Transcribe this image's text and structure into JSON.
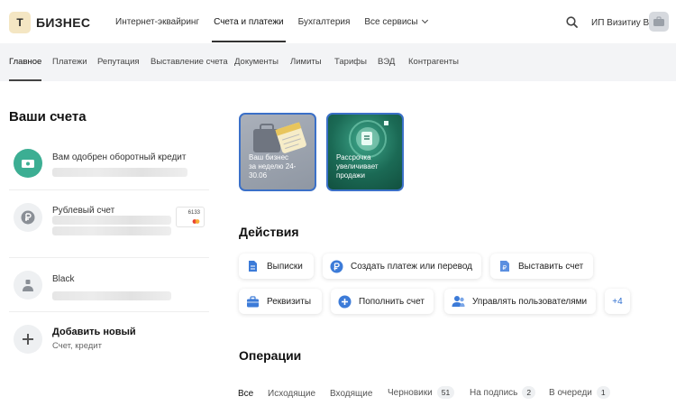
{
  "brand": {
    "logo_letter": "Т",
    "name": "БИЗНЕС"
  },
  "top_nav": [
    {
      "label": "Интернет-эквайринг",
      "active": false
    },
    {
      "label": "Счета и платежи",
      "active": true
    },
    {
      "label": "Бухгалтерия",
      "active": false
    },
    {
      "label": "Все сервисы",
      "active": false
    }
  ],
  "user": {
    "name": "ИП Визитиу В."
  },
  "sub_nav": [
    {
      "label": "Главное",
      "active": true
    },
    {
      "label": "Платежи"
    },
    {
      "label": "Репутация"
    },
    {
      "label": "Выставление счета"
    },
    {
      "label": "Документы"
    },
    {
      "label": "Лимиты"
    },
    {
      "label": "Тарифы"
    },
    {
      "label": "ВЭД"
    },
    {
      "label": "Контрагенты"
    }
  ],
  "accounts": {
    "title": "Ваши счета",
    "items": [
      {
        "label": "Вам одобрен оборотный кредит",
        "icon": "banknote-icon",
        "color": "#3cae93"
      },
      {
        "label": "Рублевый счет",
        "icon": "ruble-icon",
        "card_last4": "6133"
      },
      {
        "label": "Black",
        "icon": "person-icon"
      }
    ],
    "add": {
      "title": "Добавить новый",
      "subtitle": "Счет, кредит"
    }
  },
  "promos": [
    {
      "text_lines": [
        "Ваш бизнес",
        "за неделю 24-",
        "30.06"
      ]
    },
    {
      "text_lines": [
        "Рассрочка",
        "увеличивает",
        "продажи"
      ]
    }
  ],
  "actions": {
    "title": "Действия",
    "buttons": [
      {
        "label": "Выписки",
        "icon": "document-icon"
      },
      {
        "label": "Создать платеж или перевод",
        "icon": "ruble-circle-icon"
      },
      {
        "label": "Выставить счет",
        "icon": "invoice-icon"
      },
      {
        "label": "Реквизиты",
        "icon": "briefcase-icon"
      },
      {
        "label": "Пополнить счет",
        "icon": "plus-circle-icon"
      },
      {
        "label": "Управлять пользователями",
        "icon": "users-icon"
      }
    ],
    "more": "+4"
  },
  "operations": {
    "title": "Операции",
    "tabs": [
      {
        "label": "Все",
        "active": true
      },
      {
        "label": "Исходящие"
      },
      {
        "label": "Входящие"
      },
      {
        "label": "Черновики",
        "count": "51"
      },
      {
        "label": "На подпись",
        "count": "2"
      },
      {
        "label": "В очереди",
        "count": "1"
      }
    ]
  },
  "colors": {
    "accent": "#2f6fd0",
    "brand_yellow": "#f4e6c3",
    "credit_green": "#3cae93"
  }
}
